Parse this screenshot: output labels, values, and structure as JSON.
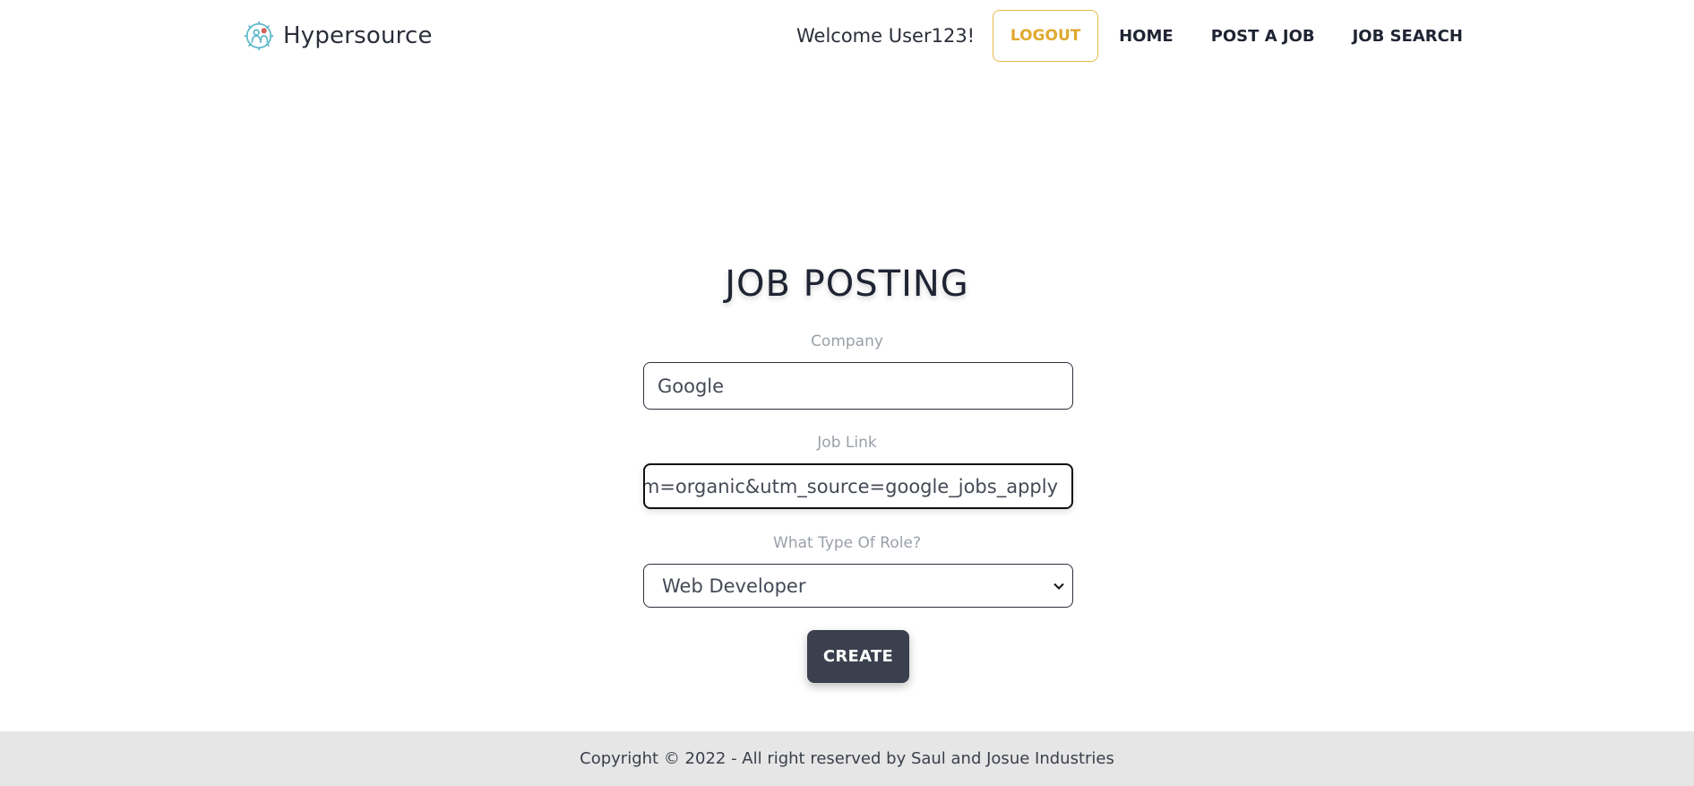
{
  "header": {
    "brand_name": "Hypersource",
    "brand_icon": "gear-people-icon",
    "welcome_text": "Welcome User123!",
    "logout_label": "LOGOUT",
    "nav": {
      "home": "HOME",
      "post_job": "POST A JOB",
      "job_search": "JOB SEARCH"
    }
  },
  "form": {
    "title": "JOB POSTING",
    "company": {
      "label": "Company",
      "value": "Google"
    },
    "job_link": {
      "label": "Job Link",
      "value": "m=organic&utm_source=google_jobs_apply"
    },
    "role": {
      "label": "What Type Of Role?",
      "selected": "Web Developer",
      "icon": "chevron-down-icon"
    },
    "create_label": "CREATE"
  },
  "footer": {
    "copyright": "Copyright © 2022 - All right reserved by Saul and Josue Industries"
  },
  "colors": {
    "accent": "#e0a82e",
    "button_dark": "#3a404d",
    "footer_bg": "#e6e6e6",
    "brand_icon": "#5bb8c9"
  }
}
